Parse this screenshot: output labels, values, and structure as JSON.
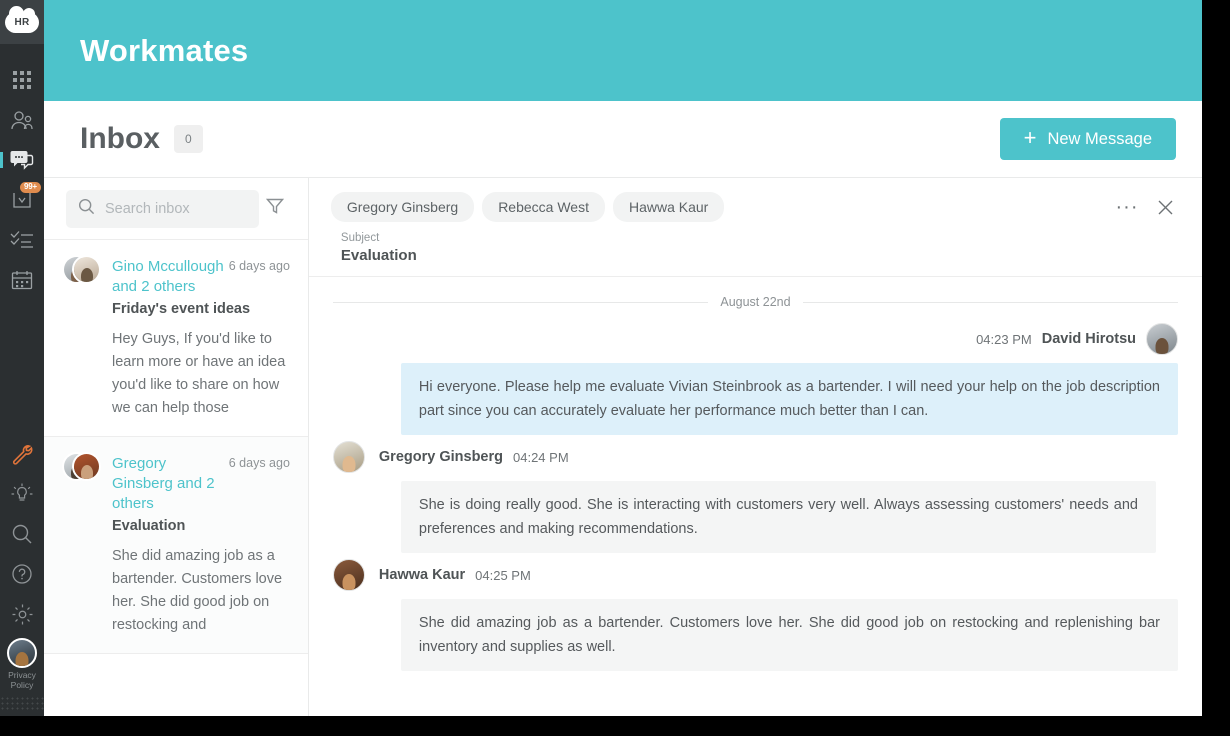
{
  "brand": {
    "logo_text": "HR",
    "accent": "#4dc3cb",
    "rail_bg": "#2b2f31"
  },
  "rail": {
    "items": [
      {
        "icon": "grid-apps-icon",
        "name": "apps"
      },
      {
        "icon": "people-icon",
        "name": "people"
      },
      {
        "icon": "chat-bubble-icon",
        "name": "messages",
        "active": true
      },
      {
        "icon": "inbox-tray-icon",
        "name": "notifications",
        "badge": "99+"
      },
      {
        "icon": "checklist-icon",
        "name": "tasks"
      },
      {
        "icon": "calendar-icon",
        "name": "calendar"
      }
    ],
    "bottom_items": [
      {
        "icon": "wrench-icon",
        "name": "tools"
      },
      {
        "icon": "lightbulb-icon",
        "name": "ideas"
      },
      {
        "icon": "search-icon",
        "name": "search"
      },
      {
        "icon": "help-circle-icon",
        "name": "help"
      },
      {
        "icon": "gear-icon",
        "name": "settings"
      }
    ],
    "privacy_label": "Privacy\nPolicy",
    "privacy_line1": "Privacy",
    "privacy_line2": "Policy"
  },
  "topbar": {
    "title": "Workmates"
  },
  "pagehead": {
    "title": "Inbox",
    "count": "0",
    "new_message_label": "New Message",
    "plus_glyph": "+"
  },
  "search": {
    "placeholder": "Search inbox",
    "value": "",
    "icon": "search-icon",
    "filter_icon": "filter-funnel-icon"
  },
  "conversations": [
    {
      "names": "Gino Mccullough and 2 others",
      "time": "6 days ago",
      "subject": "Friday's event ideas",
      "snippet": "Hey Guys, If you'd like to learn more or have an idea you'd like to share on how we can help those",
      "selected": false
    },
    {
      "names": "Gregory Ginsberg and 2 others",
      "time": "6 days ago",
      "subject": "Evaluation",
      "snippet": "She did amazing job as a bartender. Customers love her. She did good job on restocking and",
      "selected": true
    }
  ],
  "thread": {
    "recipients": [
      "Gregory Ginsberg",
      "Rebecca West",
      "Hawwa Kaur"
    ],
    "more_glyph": "···",
    "close_glyph": "×",
    "subject_label": "Subject",
    "subject_value": "Evaluation",
    "date_separator": "August 22nd",
    "messages": [
      {
        "author": "David Hirotsu",
        "time": "04:23 PM",
        "text": "Hi everyone. Please help me evaluate Vivian Steinbrook as a bartender. I will need your help on the job description part since you can accurately evaluate her performance much better than I can.",
        "outgoing": true,
        "bubble_color": "#ddf0fa"
      },
      {
        "author": "Gregory Ginsberg",
        "time": "04:24 PM",
        "text": "She is doing really good. She is interacting with customers very well. Always assessing customers' needs and preferences and making recommendations.",
        "outgoing": false,
        "bubble_color": "#f4f5f5"
      },
      {
        "author": "Hawwa Kaur",
        "time": "04:25 PM",
        "text": "She did amazing job as a bartender. Customers love her. She did good job on restocking and replenishing bar inventory and supplies as well.",
        "outgoing": false,
        "bubble_color": "#f4f5f5"
      }
    ]
  }
}
